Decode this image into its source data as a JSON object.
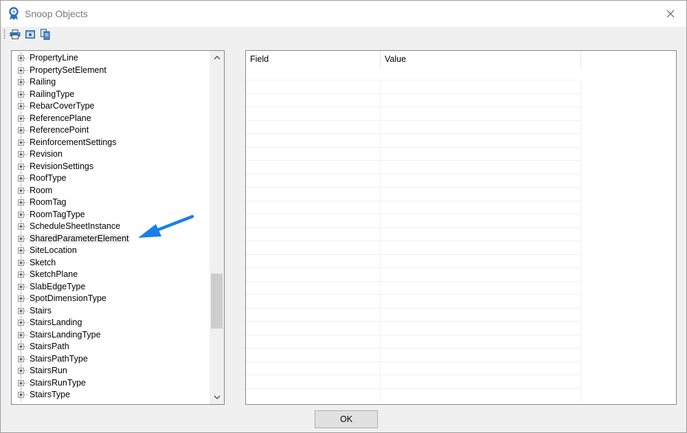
{
  "window": {
    "title": "Snoop Objects"
  },
  "toolbar": {
    "buttons": [
      {
        "icon": "printer-icon"
      },
      {
        "icon": "preview-icon"
      },
      {
        "icon": "copy-icon"
      }
    ]
  },
  "tree": {
    "items": [
      {
        "label": "PropertyLine"
      },
      {
        "label": "PropertySetElement"
      },
      {
        "label": "Railing"
      },
      {
        "label": "RailingType"
      },
      {
        "label": "RebarCoverType"
      },
      {
        "label": "ReferencePlane"
      },
      {
        "label": "ReferencePoint"
      },
      {
        "label": "ReinforcementSettings"
      },
      {
        "label": "Revision"
      },
      {
        "label": "RevisionSettings"
      },
      {
        "label": "RoofType"
      },
      {
        "label": "Room"
      },
      {
        "label": "RoomTag"
      },
      {
        "label": "RoomTagType"
      },
      {
        "label": "ScheduleSheetInstance"
      },
      {
        "label": "SharedParameterElement",
        "selected": true
      },
      {
        "label": "SiteLocation"
      },
      {
        "label": "Sketch"
      },
      {
        "label": "SketchPlane"
      },
      {
        "label": "SlabEdgeType"
      },
      {
        "label": "SpotDimensionType"
      },
      {
        "label": "Stairs"
      },
      {
        "label": "StairsLanding"
      },
      {
        "label": "StairsLandingType"
      },
      {
        "label": "StairsPath"
      },
      {
        "label": "StairsPathType"
      },
      {
        "label": "StairsRun"
      },
      {
        "label": "StairsRunType"
      },
      {
        "label": "StairsType"
      }
    ]
  },
  "grid": {
    "columns": [
      "Field",
      "Value",
      ""
    ]
  },
  "footer": {
    "ok_label": "OK"
  },
  "colors": {
    "accent_arrow": "#1a7fe8",
    "title_icon": "#2e6fbf"
  }
}
